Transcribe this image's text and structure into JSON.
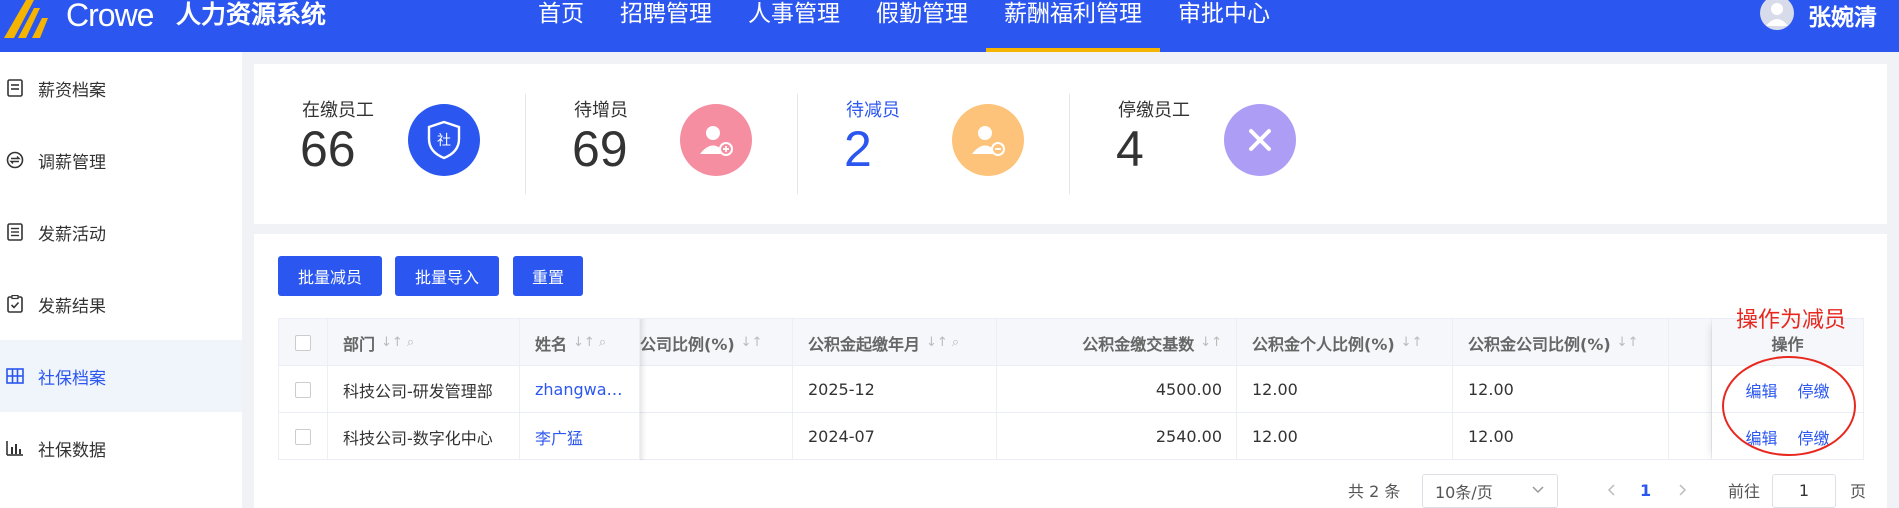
{
  "header": {
    "brand": "Crowe",
    "app_title": "人力资源系统",
    "nav": [
      "首页",
      "招聘管理",
      "人事管理",
      "假勤管理",
      "薪酬福利管理",
      "审批中心"
    ],
    "active_nav": "薪酬福利管理",
    "user_name": "张婉清",
    "brand_color": "#2b57f0",
    "active_color": "#f4b400"
  },
  "sidebar": {
    "items": [
      {
        "label": "薪资档案",
        "icon": "document-icon"
      },
      {
        "label": "调薪管理",
        "icon": "exchange-icon"
      },
      {
        "label": "发薪活动",
        "icon": "list-icon"
      },
      {
        "label": "发薪结果",
        "icon": "clipboard-check-icon"
      },
      {
        "label": "社保档案",
        "icon": "grid-icon",
        "active": true
      },
      {
        "label": "社保数据",
        "icon": "bar-chart-icon"
      }
    ]
  },
  "stats": [
    {
      "label": "在缴员工",
      "value": "66",
      "icon": "shield-icon",
      "icon_text": "社",
      "color": "#2b57f0"
    },
    {
      "label": "待增员",
      "value": "69",
      "icon": "user-add-icon",
      "color": "#f58ea0"
    },
    {
      "label": "待减员",
      "value": "2",
      "icon": "user-minus-icon",
      "color": "#fdc37a"
    },
    {
      "label": "停缴员工",
      "value": "4",
      "icon": "close-icon",
      "color": "#ad9df5"
    }
  ],
  "toolbar": {
    "batch_reduce": "批量减员",
    "batch_import": "批量导入",
    "reset": "重置"
  },
  "table": {
    "columns": [
      "部门",
      "姓名",
      "公司比例(%)",
      "公积金起缴年月",
      "公积金缴交基数",
      "公积金个人比例(%)",
      "公积金公司比例(%)",
      "操作"
    ],
    "rows": [
      {
        "dept": "科技公司-研发管理部",
        "name": "zhangwa…",
        "company_ratio": "",
        "start": "2025-12",
        "base": "4500.00",
        "personal": "12.00",
        "company": "12.00",
        "edit": "编辑",
        "stop": "停缴"
      },
      {
        "dept": "科技公司-数字化中心",
        "name": "李广猛",
        "company_ratio": "",
        "start": "2024-07",
        "base": "2540.00",
        "personal": "12.00",
        "company": "12.00",
        "edit": "编辑",
        "stop": "停缴"
      }
    ]
  },
  "pagination": {
    "total": "共 2 条",
    "page_size": "10条/页",
    "current": "1",
    "goto_prefix": "前往",
    "goto_value": "1",
    "goto_suffix": "页"
  },
  "annotation": {
    "text": "操作为减员",
    "color": "#e8281f"
  }
}
